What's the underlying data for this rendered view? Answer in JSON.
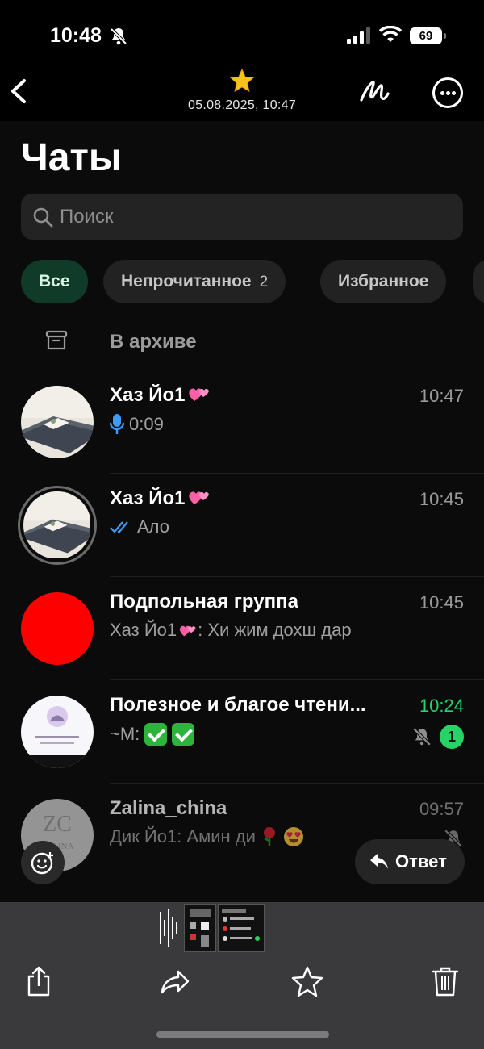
{
  "status_bar": {
    "time": "10:48",
    "battery": "69"
  },
  "viewer": {
    "date": "05.08.2025, 10:47"
  },
  "chats_screen": {
    "title": "Чаты",
    "search_placeholder": "Поиск",
    "filters": [
      {
        "label": "Все",
        "active": true
      },
      {
        "label": "Непрочитанное",
        "count": "2"
      },
      {
        "label": "Избранное"
      }
    ],
    "archive_label": "В архиве",
    "chats": [
      {
        "name": "Хаз Йо1",
        "time": "10:47",
        "preview": "0:09",
        "preview_type": "voice"
      },
      {
        "name": "Хаз Йо1",
        "time": "10:45",
        "preview": "Ало",
        "preview_type": "read"
      },
      {
        "name": "Подпольная группа",
        "time": "10:45",
        "preview_sender": "Хаз Йо1",
        "preview": ": Хи жим дохш дар"
      },
      {
        "name": "Полезное и благое чтени...",
        "time": "10:24",
        "preview_sender": "~М:",
        "unread": "1",
        "muted": true
      },
      {
        "name": "Zalina_china",
        "time": "09:57",
        "preview": "Дик Йо1: Амин ди",
        "muted": true
      }
    ],
    "reply_button": "Ответ"
  },
  "colors": {
    "accent_green": "#25d366",
    "active_chip": "#103b29",
    "avatar_red": "#ff0000"
  }
}
